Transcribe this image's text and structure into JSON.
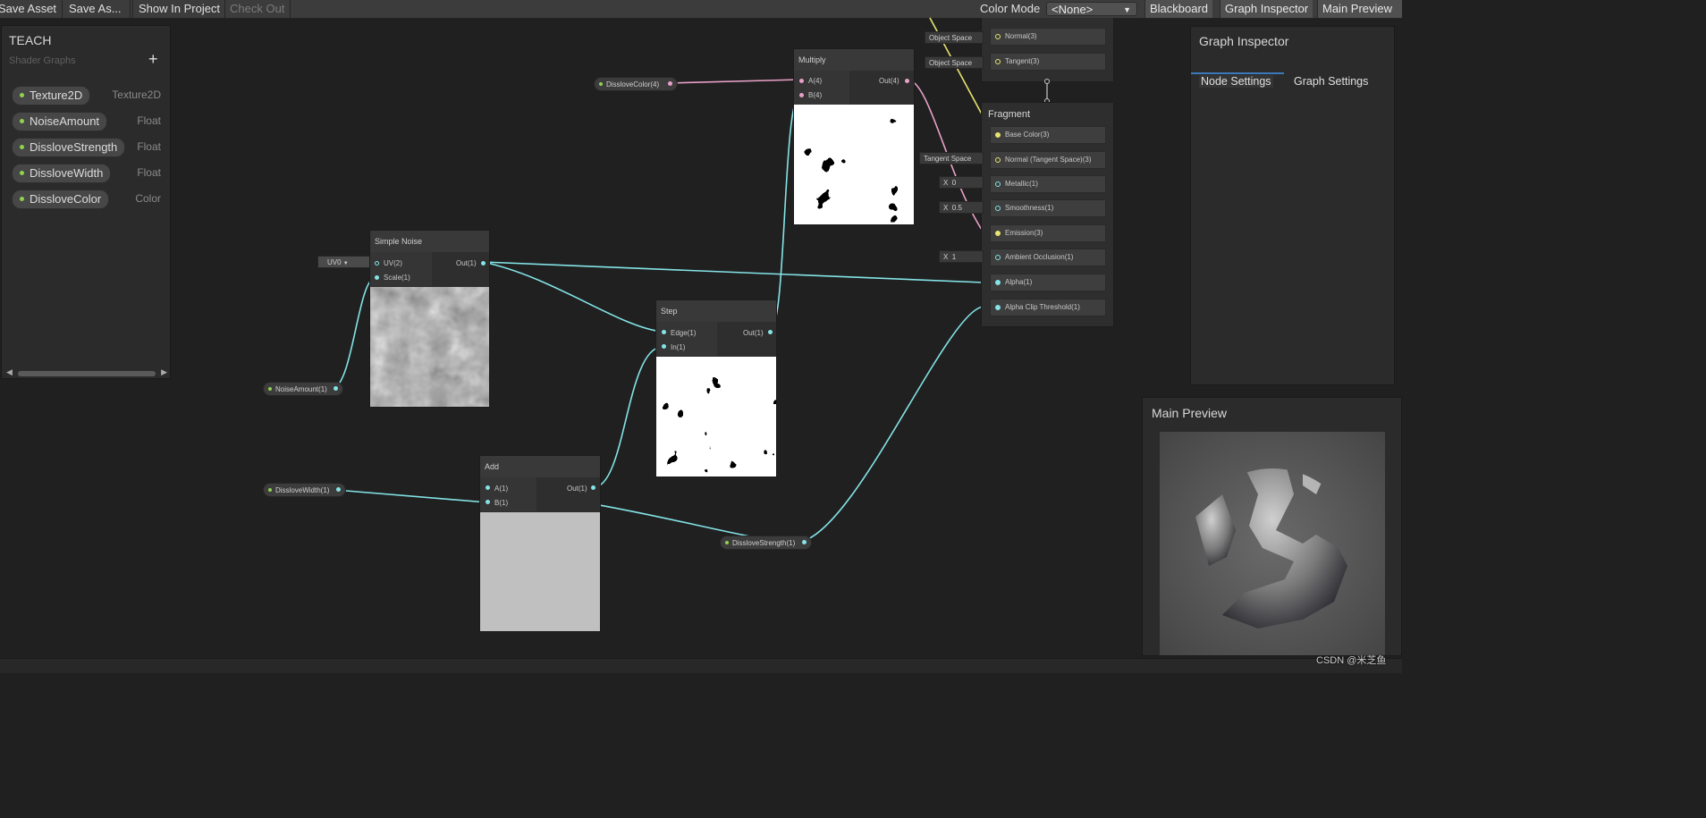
{
  "toolbar": {
    "save_asset": "Save Asset",
    "save_as": "Save As...",
    "show_in_project": "Show In Project",
    "check_out": "Check Out",
    "color_mode_label": "Color Mode",
    "color_mode_value": "<None>",
    "blackboard": "Blackboard",
    "graph_inspector": "Graph Inspector",
    "main_preview": "Main Preview"
  },
  "blackboard": {
    "title": "TEACH",
    "subtitle": "Shader Graphs",
    "add_label": "+",
    "properties": [
      {
        "name": "Texture2D",
        "type": "Texture2D"
      },
      {
        "name": "NoiseAmount",
        "type": "Float"
      },
      {
        "name": "DissloveStrength",
        "type": "Float"
      },
      {
        "name": "DissloveWidth",
        "type": "Float"
      },
      {
        "name": "DissloveColor",
        "type": "Color"
      }
    ]
  },
  "nodes": {
    "simple_noise": {
      "title": "Simple Noise",
      "in_uv": "UV(2)",
      "in_scale": "Scale(1)",
      "out": "Out(1)",
      "uv_field": "UV0"
    },
    "multiply": {
      "title": "Multiply",
      "in_a": "A(4)",
      "in_b": "B(4)",
      "out": "Out(4)"
    },
    "step": {
      "title": "Step",
      "in_edge": "Edge(1)",
      "in_in": "In(1)",
      "out": "Out(1)"
    },
    "add": {
      "title": "Add",
      "in_a": "A(1)",
      "in_b": "B(1)",
      "out": "Out(1)"
    }
  },
  "property_nodes": {
    "dissolve_color": "DissloveColor(4)",
    "noise_amount": "NoiseAmount(1)",
    "dissolve_width": "DissloveWidth(1)",
    "dissolve_strength": "DissloveStrength(1)"
  },
  "master": {
    "vertex_slots": [
      {
        "label": "Normal(3)",
        "space": "Object Space"
      },
      {
        "label": "Tangent(3)",
        "space": "Object Space"
      }
    ],
    "fragment_title": "Fragment",
    "fragment_slots": {
      "base_color": "Base Color(3)",
      "normal": "Normal (Tangent Space)(3)",
      "normal_space": "Tangent Space",
      "metallic": "Metallic(1)",
      "metallic_x": "X",
      "metallic_value": "0",
      "smoothness": "Smoothness(1)",
      "smoothness_x": "X",
      "smoothness_value": "0.5",
      "emission": "Emission(3)",
      "ambient_occlusion": "Ambient Occlusion(1)",
      "ao_x": "X",
      "ao_value": "1",
      "alpha": "Alpha(1)",
      "alpha_clip": "Alpha Clip Threshold(1)"
    }
  },
  "inspector": {
    "title": "Graph Inspector",
    "tab_node": "Node Settings",
    "tab_graph": "Graph Settings"
  },
  "preview": {
    "title": "Main Preview"
  },
  "watermark": "CSDN @米芝鱼",
  "colors": {
    "float_wire": "#84e4e7",
    "color_wire": "#e8a0c8",
    "vec3_wire": "#e8e46f",
    "property_dot": "#8fd14f"
  }
}
